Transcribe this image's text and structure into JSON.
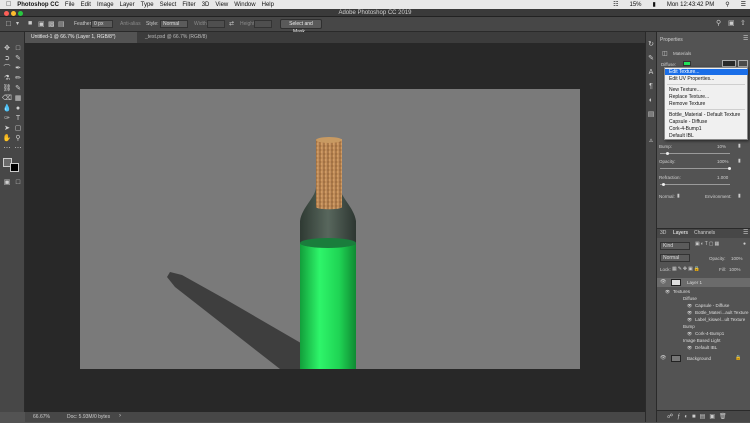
{
  "menubar": {
    "app": "Photoshop CC",
    "items": [
      "File",
      "Edit",
      "Image",
      "Layer",
      "Type",
      "Select",
      "Filter",
      "3D",
      "View",
      "Window",
      "Help"
    ],
    "battery": "15%",
    "clock": "Mon 12:43:42 PM"
  },
  "window": {
    "title": "Adobe Photoshop CC 2019"
  },
  "options": {
    "feather_label": "Feather:",
    "feather_value": "0 px",
    "antialias_label": "Anti-alias",
    "style_label": "Style:",
    "style_value": "Normal",
    "width_label": "Width:",
    "height_label": "Height:",
    "select_mask_button": "Select and Mask..."
  },
  "tabs": [
    {
      "label": "Untitled-1 @ 66.7% (Layer 1, RGB/8*)"
    },
    {
      "label": "_test.psd @ 66.7% (RGB/8)"
    }
  ],
  "status": {
    "zoom": "66.67%",
    "doc": "Doc: 5.93M/0 bytes"
  },
  "properties": {
    "tab": "Properties",
    "section": "Materials",
    "diffuse_label": "Diffuse:",
    "bump_label": "Bump:",
    "bump_value": "10%",
    "opacity_label": "Opacity:",
    "opacity_value": "100%",
    "refraction_label": "Refraction:",
    "refraction_value": "1.000",
    "normal_label": "Normal:",
    "environment_label": "Environment:"
  },
  "context_menu": {
    "items": [
      "Edit Texture...",
      "Edit UV Properties...",
      "New Texture...",
      "Replace Texture...",
      "Remove Texture",
      "Bottle_Material - Default Texture",
      "Capsule - Diffuse",
      "Cork-4-Bump1",
      "Default IBL"
    ]
  },
  "layers": {
    "tabs": [
      "3D",
      "Layers",
      "Channels"
    ],
    "kind": "Kind",
    "blend": "Normal",
    "opacity_label": "Opacity:",
    "opacity_value": "100%",
    "lock_label": "Lock:",
    "fill_label": "Fill:",
    "fill_value": "100%",
    "rows": [
      "Layer 1",
      "Textures",
      "Diffuse",
      "Capsule - Diffuse",
      "Bottle_Materi...ault Texture",
      "Label_kiswel...ult Texture",
      "Bump",
      "Cork-4-Bump1",
      "Image Based Light",
      "Default IBL",
      "Background"
    ]
  },
  "colors": {
    "bottle_green": "#22e35a",
    "cork": "#c8915a",
    "canvas_gray": "#7a7a7a",
    "highlight_blue": "#1a6ee8"
  }
}
